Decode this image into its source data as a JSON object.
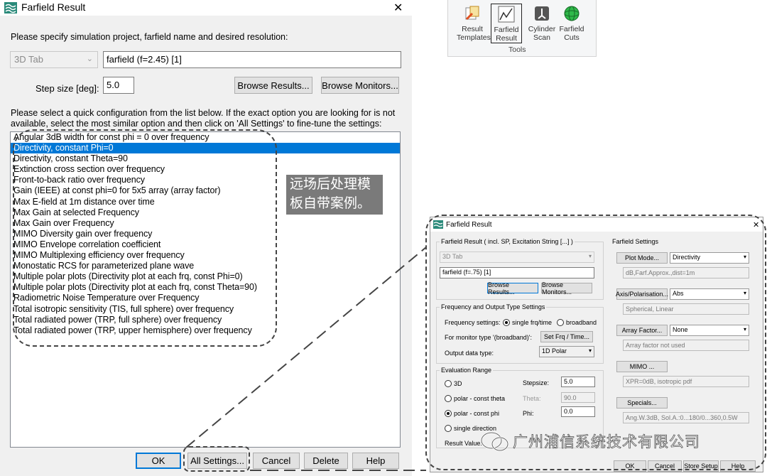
{
  "dialog": {
    "title": "Farfield Result",
    "close_glyph": "✕",
    "prompt1": "Please specify simulation project, farfield name and desired resolution:",
    "project_combo": "3D Tab",
    "farfield_name": "farfield (f=2.45) [1]",
    "step_label": "Step size [deg]:",
    "step_value": "5.0",
    "browse_results": "Browse Results...",
    "browse_monitors": "Browse Monitors...",
    "prompt2_line1": "Please select a quick configuration from the list below. If the exact option you are looking for is not",
    "prompt2_line2": "available, select the most similar option and then click on 'All Settings' to fine-tune the settings:",
    "list_items": [
      "Angular 3dB width for const phi = 0 over frequency",
      "Directivity, constant Phi=0",
      "Directivity, constant Theta=90",
      "Extinction cross section over frequency",
      "Front-to-back ratio over frequency",
      "Gain (IEEE) at const phi=0 for 5x5 array (array factor)",
      "Max E-field at 1m distance over time",
      "Max Gain at selected Frequency",
      "Max Gain over Frequency",
      "MIMO Diversity gain over frequency",
      "MIMO Envelope correlation coefficient",
      "MIMO Multiplexing efficiency over frequency",
      "Monostatic RCS for parameterized plane wave",
      "Multiple polar plots (Directivity plot at each frq, const Phi=0)",
      "Multiple polar plots (Directivity plot at each frq, const Theta=90)",
      "Radiometric Noise Temperature over Frequency",
      "Total isotropic sensitivity (TIS, full sphere) over frequency",
      "Total radiated power (TRP, full sphere) over frequency",
      "Total radiated power (TRP, upper hemisphere) over frequency"
    ],
    "selected_index": 1,
    "ok": "OK",
    "all_settings": "All Settings...",
    "cancel": "Cancel",
    "delete": "Delete",
    "help": "Help"
  },
  "annotation": {
    "line1": "远场后处理模",
    "line2": "板自带案例。"
  },
  "ribbon": {
    "items": [
      {
        "line1": "Result",
        "line2": "Templates"
      },
      {
        "line1": "Farfield",
        "line2": "Result"
      },
      {
        "line1": "Cylinder",
        "line2": "Scan"
      },
      {
        "line1": "Farfield",
        "line2": "Cuts"
      }
    ],
    "group_label": "Tools"
  },
  "dialog2": {
    "title": "Farfield Result",
    "close_glyph": "✕",
    "group_result": "Farfield Result ( incl. SP, Excitation String [...] )",
    "project_combo": "3D Tab",
    "farfield_name": "farfield (f=.75) [1]",
    "browse_results": "Browse Results...",
    "browse_monitors": "Browse Monitors...",
    "group_freq": "Frequency and Output Type Settings",
    "freq_settings_label": "Frequency settings:",
    "radio_single": "single frq/time",
    "radio_broadband": "broadband",
    "monitor_type_label": "For monitor type '(broadband)':",
    "set_frq_button": "Set Frq / Time...",
    "output_type_label": "Output data type:",
    "output_type_value": "1D Polar",
    "group_eval": "Evaluation Range",
    "radio_3d": "3D",
    "radio_theta": "polar - const theta",
    "radio_phi": "polar - const phi",
    "radio_single_dir": "single direction",
    "stepsize_label": "Stepsize:",
    "stepsize_value": "5.0",
    "theta_label": "Theta:",
    "theta_value": "90.0",
    "phi_label": "Phi:",
    "phi_value": "0.0",
    "result_value_label": "Result Value:",
    "group_settings": "Farfield Settings",
    "plot_mode_button": "Plot Mode...",
    "plot_mode_value": "Directivity",
    "plot_mode_info": "dB,Farf.Approx.,dist=1m",
    "axis_button": "Axis/Polarisation...",
    "axis_value": "Abs",
    "axis_info": "Spherical, Linear",
    "array_button": "Array Factor...",
    "array_value": "None",
    "array_info": "Array factor not used",
    "mimo_button": "MIMO ...",
    "mimo_info": "XPR=0dB, isotropic pdf",
    "specials_button": "Specials...",
    "specials_info": "Ang.W.3dB, Sol.A.:0...180/0...360,0.5W",
    "ok": "OK",
    "cancel": "Cancel",
    "store": "Store Setup",
    "help": "Help"
  },
  "watermark": "广州浦信系统技术有限公司"
}
